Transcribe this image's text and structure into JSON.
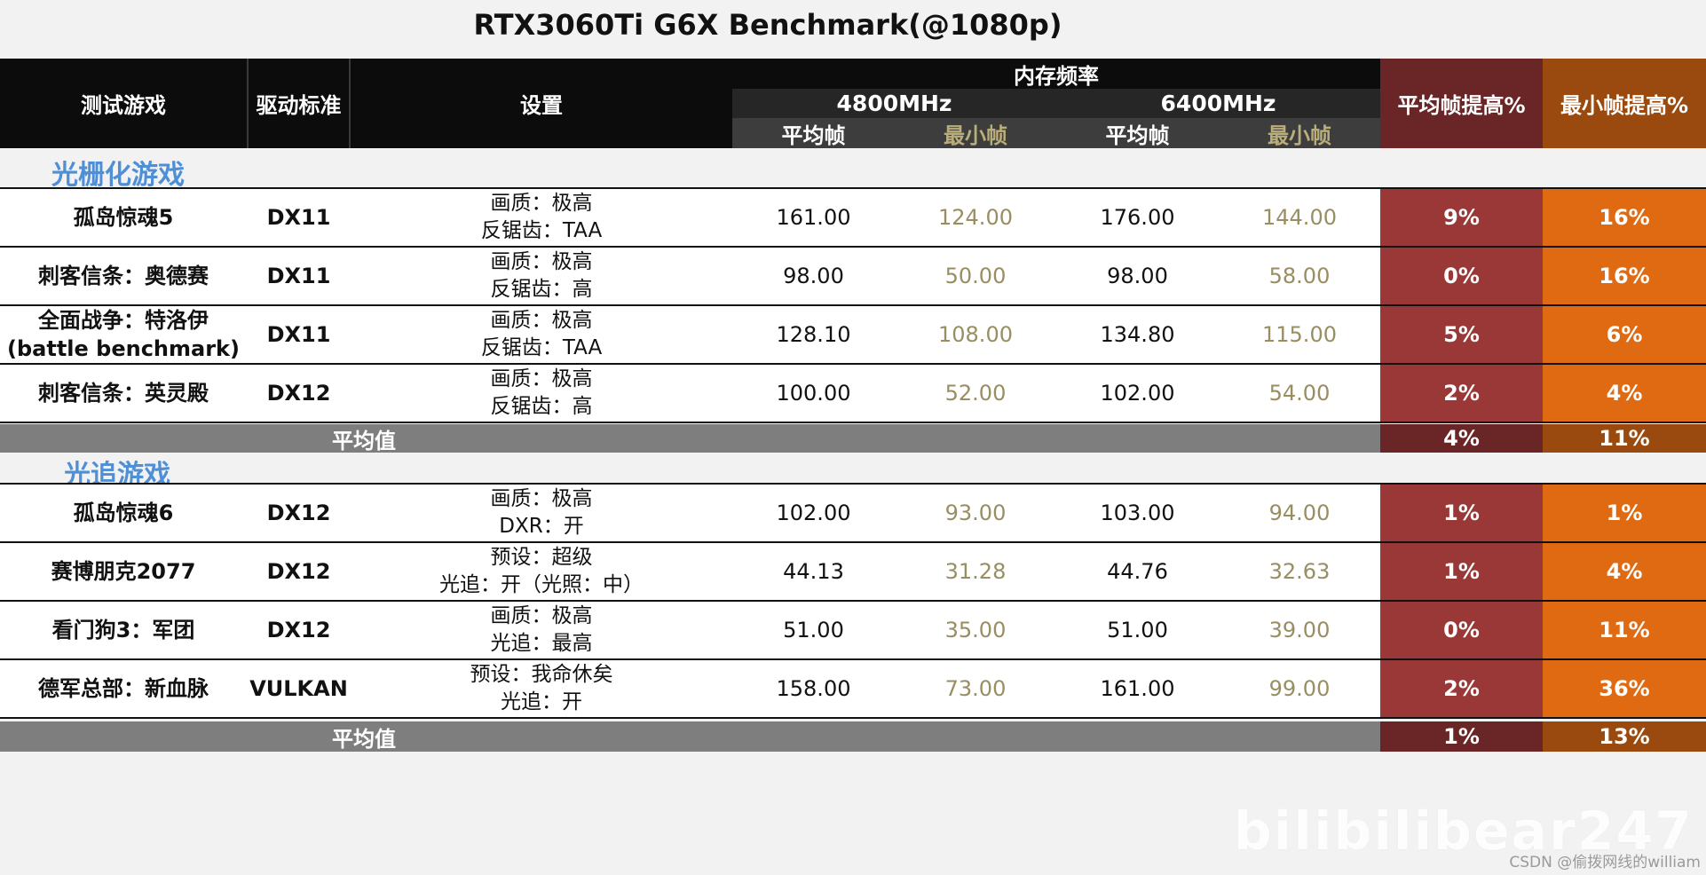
{
  "chart_data": {
    "type": "table",
    "title": "RTX3060Ti G6X Benchmark(@1080p)",
    "headers": {
      "game": "测试游戏",
      "api": "驱动标准",
      "settings": "设置",
      "mem_freq": "内存频率",
      "freq_a": "4800MHz",
      "freq_b": "6400MHz",
      "avg_fps": "平均帧",
      "min_fps": "最小帧",
      "avg_gain": "平均帧提高%",
      "min_gain": "最小帧提高%"
    },
    "sections": [
      {
        "title": "光栅化游戏",
        "rows": [
          {
            "game": [
              "孤岛惊魂5"
            ],
            "api": "DX11",
            "settings": [
              "画质：极高",
              "反锯齿：TAA"
            ],
            "avg_4800": "161.00",
            "min_4800": "124.00",
            "avg_6400": "176.00",
            "min_6400": "144.00",
            "avg_gain": "9%",
            "min_gain": "16%"
          },
          {
            "game": [
              "刺客信条：奥德赛"
            ],
            "api": "DX11",
            "settings": [
              "画质：极高",
              "反锯齿：高"
            ],
            "avg_4800": "98.00",
            "min_4800": "50.00",
            "avg_6400": "98.00",
            "min_6400": "58.00",
            "avg_gain": "0%",
            "min_gain": "16%"
          },
          {
            "game": [
              "全面战争：特洛伊",
              "(battle benchmark)"
            ],
            "api": "DX11",
            "settings": [
              "画质：极高",
              "反锯齿：TAA"
            ],
            "avg_4800": "128.10",
            "min_4800": "108.00",
            "avg_6400": "134.80",
            "min_6400": "115.00",
            "avg_gain": "5%",
            "min_gain": "6%"
          },
          {
            "game": [
              "刺客信条：英灵殿"
            ],
            "api": "DX12",
            "settings": [
              "画质：极高",
              "反锯齿：高"
            ],
            "avg_4800": "100.00",
            "min_4800": "52.00",
            "avg_6400": "102.00",
            "min_6400": "54.00",
            "avg_gain": "2%",
            "min_gain": "4%"
          }
        ],
        "average": {
          "label": "平均值",
          "avg_gain": "4%",
          "min_gain": "11%"
        }
      },
      {
        "title": "光追游戏",
        "rows": [
          {
            "game": [
              "孤岛惊魂6"
            ],
            "api": "DX12",
            "settings": [
              "画质：极高",
              "DXR：开"
            ],
            "avg_4800": "102.00",
            "min_4800": "93.00",
            "avg_6400": "103.00",
            "min_6400": "94.00",
            "avg_gain": "1%",
            "min_gain": "1%"
          },
          {
            "game": [
              "赛博朋克2077"
            ],
            "api": "DX12",
            "settings": [
              "预设：超级",
              "光追：开（光照：中）"
            ],
            "avg_4800": "44.13",
            "min_4800": "31.28",
            "avg_6400": "44.76",
            "min_6400": "32.63",
            "avg_gain": "1%",
            "min_gain": "4%"
          },
          {
            "game": [
              "看门狗3：军团"
            ],
            "api": "DX12",
            "settings": [
              "画质：极高",
              "光追：最高"
            ],
            "avg_4800": "51.00",
            "min_4800": "35.00",
            "avg_6400": "51.00",
            "min_6400": "39.00",
            "avg_gain": "0%",
            "min_gain": "11%"
          },
          {
            "game": [
              "德军总部：新血脉"
            ],
            "api": "VULKAN",
            "settings": [
              "预设：我命休矣",
              "光追：开"
            ],
            "avg_4800": "158.00",
            "min_4800": "73.00",
            "avg_6400": "161.00",
            "min_6400": "99.00",
            "avg_gain": "2%",
            "min_gain": "36%"
          }
        ],
        "average": {
          "label": "平均值",
          "avg_gain": "1%",
          "min_gain": "13%"
        }
      }
    ]
  },
  "colors": {
    "header_bg": "#0c0c0c",
    "avg_gain_bg": "#9a3838",
    "min_gain_bg": "#e06a12",
    "min_fps_text": "#988e62",
    "section_title": "#4f8fd6",
    "average_row_bg": "#7e7e7e"
  },
  "watermark": {
    "logo": "bilibili",
    "user": "bear247",
    "csdn": "CSDN @偷拨网线的william"
  }
}
